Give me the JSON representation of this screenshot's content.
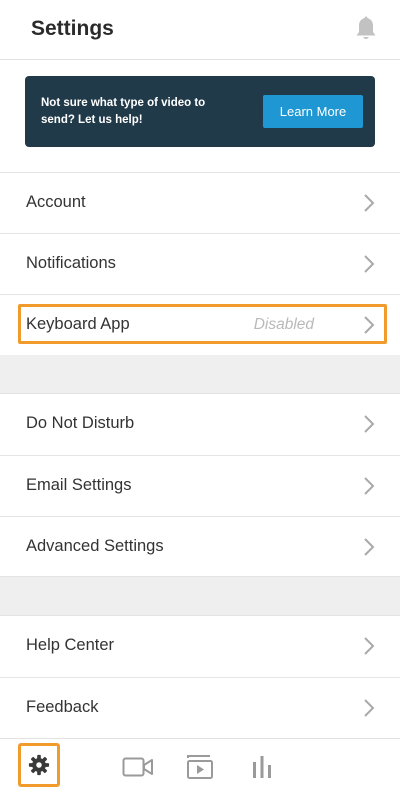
{
  "header": {
    "title": "Settings",
    "bell_icon": "bell-icon"
  },
  "banner": {
    "text": "Not sure what type of video to send? Let us help!",
    "button_label": "Learn More",
    "bg_color": "#213a4a",
    "button_color": "#1e97d3"
  },
  "groups": [
    {
      "items": [
        {
          "label": "Account"
        },
        {
          "label": "Notifications"
        },
        {
          "label": "Keyboard App",
          "value": "Disabled"
        }
      ]
    },
    {
      "items": [
        {
          "label": "Do Not Disturb"
        },
        {
          "label": "Email Settings"
        },
        {
          "label": "Advanced Settings"
        }
      ]
    },
    {
      "items": [
        {
          "label": "Help Center"
        },
        {
          "label": "Feedback"
        }
      ]
    }
  ],
  "tabbar": {
    "tabs": [
      {
        "icon": "gear-icon",
        "active": true
      },
      {
        "icon": "video-camera-icon"
      },
      {
        "icon": "video-library-icon"
      },
      {
        "icon": "bar-chart-icon"
      }
    ],
    "highlight_color": "#f29b2d"
  }
}
